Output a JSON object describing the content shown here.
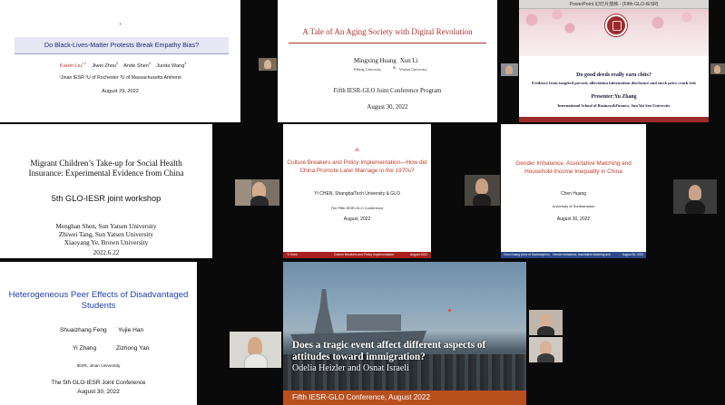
{
  "tiles": {
    "t1": {
      "title": "Do Black-Lives-Matter Protests Break Empathy Bias?",
      "authors": [
        "Kaixin Liu",
        "Jiwei Zhou",
        "Ande Shen",
        "Junda Wang"
      ],
      "author_sups": [
        "1,2",
        "2",
        "3",
        "3"
      ],
      "affiliations": "¹Jinan IESR   ²U of Rochester   ³U of Massachusetts Amherst",
      "date": "August 29, 2022",
      "colors": {
        "title_box": "#e6e6f4",
        "author_first": "#c0392b"
      }
    },
    "t2": {
      "title": "A Tale of An Aging Society with Digital Revolution",
      "author1": "Mingxing Huang",
      "author1_aff": "Peking University",
      "author2": "Xun Li",
      "author2_aff": "Wuhan University",
      "and_mark": "&",
      "conference": "Fifth IESR-GLO Joint Conference Program",
      "date": "August 30, 2022",
      "colors": {
        "title": "#b03030"
      }
    },
    "t3": {
      "window_title": "PowerPoint 幻灯片放映 - [Fifth GLO-IESR]",
      "title": "Do good deeds really earn chits?",
      "subtitle": "Evidence from targeted poverty alleviation information disclosure and stock price crash risk",
      "presenter": "Presenter:Yu Zhang",
      "affiliation": "International School of Business&Finance, Sun Yat Sen University",
      "colors": {
        "band": "#9c2b2b"
      }
    },
    "t4": {
      "title_line1": "Migrant Children’s Take-up for Social Health",
      "title_line2": "Insurance: Experimental Evidence from China",
      "workshop": "5th GLO-IESR joint workshop",
      "authors": [
        "Menghan Shen, Sun Yatsen University",
        "Zhiwei Tang, Sun Yatsen University",
        "Xiaoyang Ye, Brown University"
      ],
      "date": "2022.6.22"
    },
    "t5": {
      "title_line1": "Culture Breakers and Policy Implementation—How did",
      "title_line2": "China Promote Later Marriage in the 1970s?",
      "author": "YI CHEN, ShanghaiTech University & GLO",
      "conference": "The Fifth IESR-GLO Conference",
      "date": "August, 2022",
      "footer": [
        "Yi Chen",
        "Culture Breakers and Policy Implementation",
        "August 2022"
      ],
      "colors": {
        "title": "#c0392b",
        "footer": "#a82020"
      }
    },
    "t6": {
      "title_line1": "Gender Imbalance, Assortative Matching and",
      "title_line2": "Household Income Inequality in China",
      "author": "Chen Huang",
      "affiliation": "University of Southampton",
      "date": "August 30, 2022",
      "footer": [
        "Chen Huang (Univ of Southampton)",
        "Gender Imbalance, Assortative Matching and",
        "August 30, 2022"
      ],
      "colors": {
        "title": "#c0392b",
        "footer": "#2e4a8a"
      }
    },
    "t7": {
      "title_line1": "Heterogeneous Peer Effects of Disadvantaged",
      "title_line2": "Students",
      "authors_row1": [
        "Shuaizhang Feng",
        "Yujie Han"
      ],
      "authors_row2": [
        "Yi Zhang",
        "Zizhong Yan"
      ],
      "affiliation": "IESR, Jinan University",
      "conference": "The 5th GLO-IESR Joint Conference",
      "date": "August 30, 2022",
      "colors": {
        "title": "#1f3fb0"
      }
    },
    "t8": {
      "title_line1": "Does a tragic event affect different aspects of",
      "title_line2": "attitudes toward immigration?",
      "authors": "Odelia Heizler and Osnat Israeli",
      "footer": "Fifth IESR-GLO Conference, August 2022",
      "colors": {
        "footer": "#b8501e"
      }
    }
  },
  "participants": {
    "cam_t1": "participant-video",
    "cam_t3a": "participant-video",
    "cam_t3b": "participant-video",
    "cam_t4": "participant-video",
    "cam_t5": "participant-video",
    "cam_t6": "participant-video",
    "cam_t7": "participant-video",
    "cam_t8a": "participant-video",
    "cam_t8b": "participant-video"
  }
}
